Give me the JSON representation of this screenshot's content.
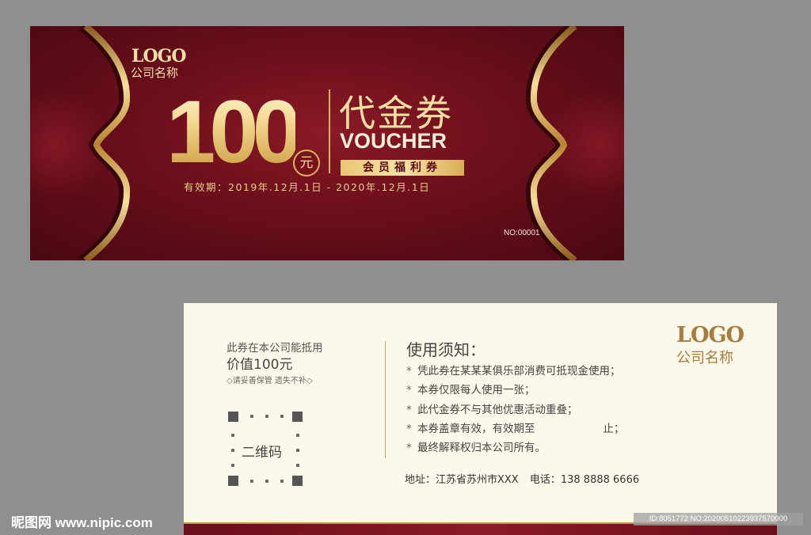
{
  "front": {
    "logo": "LOGO",
    "company": "公司名称",
    "amount": "100",
    "currency": "元",
    "title_cn": "代金券",
    "title_en": "VOUCHER",
    "badge": "会员福利券",
    "validity": "有效期：2019年.12月.1日 - 2020年.12月.1日",
    "serial": "NO:00001"
  },
  "back": {
    "line1": "此券在本公司能抵用",
    "line2": "价值100元",
    "line3": "◇请妥善保管 遗失不补◇",
    "qr_label": "二维码",
    "notice_title": "使用须知：",
    "rules": [
      "凭此券在某某某俱乐部消费可抵现金使用；",
      "本券仅限每人使用一张；",
      "此代金券不与其他优惠活动重叠；",
      "本券盖章有效，有效期至                    止；",
      "最终解释权归本公司所有。"
    ],
    "address": "地址：江苏省苏州市XXX",
    "phone": "电话：138 8888 6666",
    "logo": "LOGO",
    "company": "公司名称"
  },
  "watermark": {
    "site": "昵图网 www.nipic.com",
    "id": "ID:8051772 NO:20200510223937570000"
  },
  "colors": {
    "burgundy": "#6a0f1b",
    "gold": "#d9b45f",
    "cream": "#fdf9ea",
    "background": "#8f8f8f"
  }
}
